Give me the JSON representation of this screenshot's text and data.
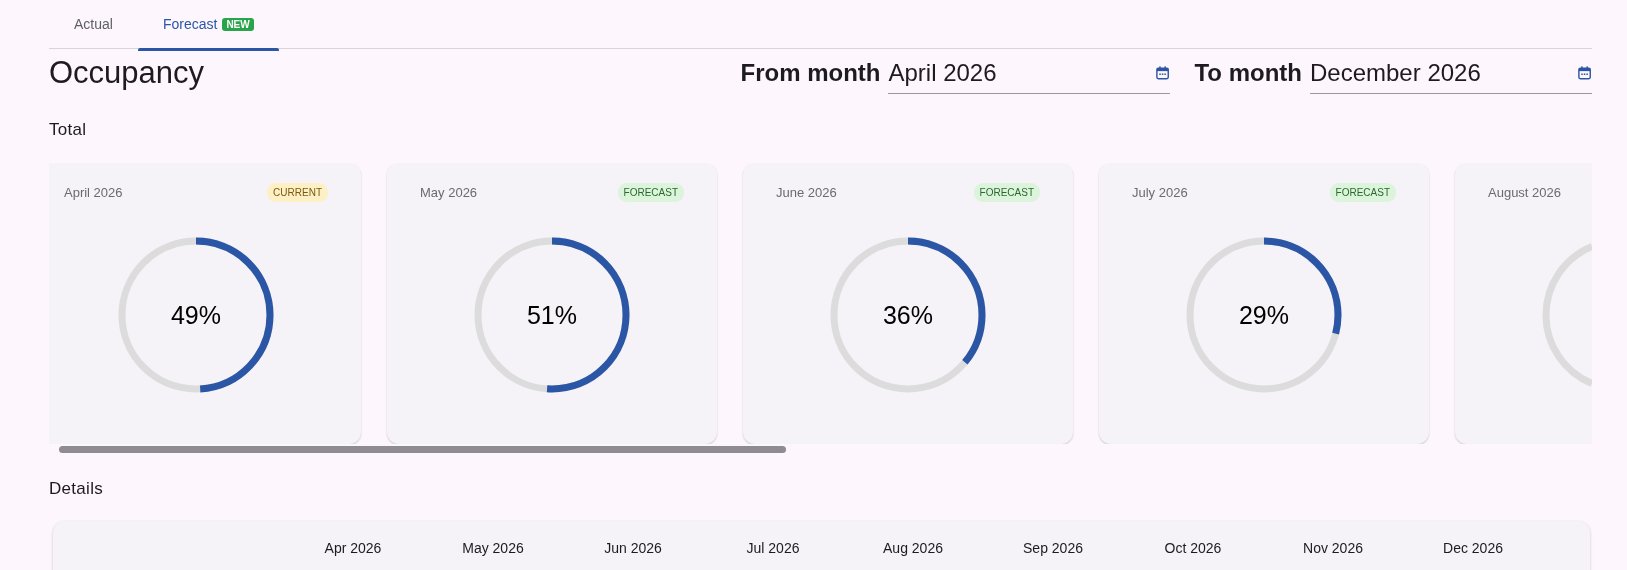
{
  "tabs": [
    {
      "label": "Actual",
      "selected": false
    },
    {
      "label": "Forecast",
      "selected": true,
      "badge": "NEW"
    }
  ],
  "title": "Occupancy",
  "filters": [
    {
      "label": "From month",
      "value": "April 2026"
    },
    {
      "label": "To month",
      "value": "December 2026"
    }
  ],
  "total": {
    "heading": "Total",
    "cards": [
      {
        "month": "April 2026",
        "status": "CURRENT",
        "kind": "current",
        "reading": "49%"
      },
      {
        "month": "May 2026",
        "status": "FORECAST",
        "kind": "forecast",
        "reading": "51%"
      },
      {
        "month": "June 2026",
        "status": "FORECAST",
        "kind": "forecast",
        "reading": "36%"
      },
      {
        "month": "July 2026",
        "status": "FORECAST",
        "kind": "forecast",
        "reading": "29%"
      },
      {
        "month": "August 2026"
      }
    ]
  },
  "details": {
    "heading": "Details",
    "columns": [
      "Apr 2026",
      "May 2026",
      "Jun 2026",
      "Jul 2026",
      "Aug 2026",
      "Sep 2026",
      "Oct 2026",
      "Nov 2026",
      "Dec 2026"
    ]
  }
}
